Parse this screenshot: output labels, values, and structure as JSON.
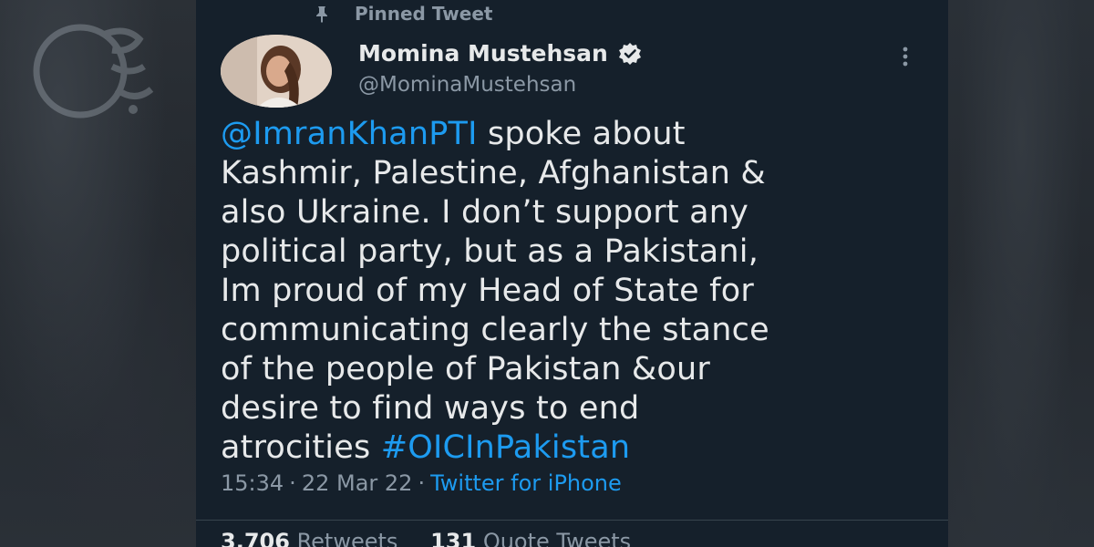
{
  "pinned": {
    "label": "Pinned Tweet",
    "icon": "pin-icon"
  },
  "author": {
    "display_name": "Momina Mustehsan",
    "handle": "@MominaMustehsan",
    "verified_icon": "verified-badge-icon"
  },
  "tweet": {
    "lines": [
      {
        "parts": [
          {
            "text": "@ImranKhanPTI",
            "link": true
          },
          {
            "text": " spoke about",
            "link": false
          }
        ]
      },
      {
        "parts": [
          {
            "text": "Kashmir, Palestine, Afghanistan &",
            "link": false
          }
        ]
      },
      {
        "parts": [
          {
            "text": "also Ukraine. I don’t support any",
            "link": false
          }
        ]
      },
      {
        "parts": [
          {
            "text": "political party, but as a Pakistani,",
            "link": false
          }
        ]
      },
      {
        "parts": [
          {
            "text": "Im proud of my Head of State for",
            "link": false
          }
        ]
      },
      {
        "parts": [
          {
            "text": "communicating clearly the stance",
            "link": false
          }
        ]
      },
      {
        "parts": [
          {
            "text": "of the people of Pakistan &our",
            "link": false
          }
        ]
      },
      {
        "parts": [
          {
            "text": "desire to find ways to end",
            "link": false
          }
        ]
      },
      {
        "parts": [
          {
            "text": "atrocities ",
            "link": false
          },
          {
            "text": "#OICInPakistan",
            "link": true
          }
        ]
      }
    ]
  },
  "meta": {
    "time": "15:34",
    "separator": "·",
    "date": "22 Mar 22",
    "source": "Twitter for iPhone"
  },
  "stats": {
    "retweets_count": "3,706",
    "retweets_label": "Retweets",
    "quotes_count": "131",
    "quotes_label": "Quote Tweets"
  },
  "colors": {
    "background": "#15202b",
    "text": "#e7e9ea",
    "muted": "#8b98a5",
    "link": "#1d9bf0"
  }
}
